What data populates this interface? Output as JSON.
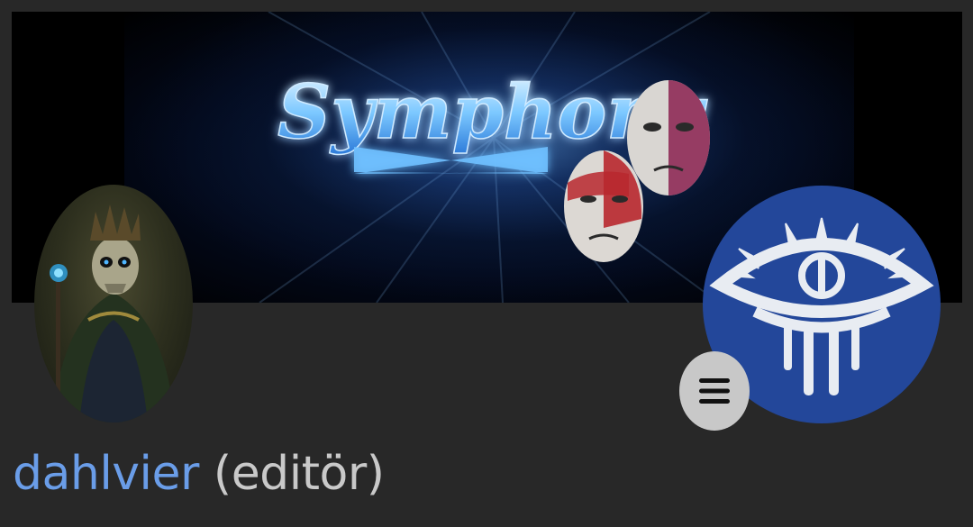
{
  "profile": {
    "username": "dahlvier",
    "role": "(editör)"
  },
  "banner": {
    "logo_text": "Symphony",
    "logo_mark": "X"
  },
  "icons": {
    "menu": "hamburger-menu-icon",
    "right_avatar": "eye-emblem-icon",
    "left_avatar": "skeleton-king-portrait"
  },
  "colors": {
    "background": "#282828",
    "username": "#6a9de8",
    "role": "#c9c9c9",
    "emblem_blue": "#23479a",
    "menu_button": "#c8c8c8"
  }
}
